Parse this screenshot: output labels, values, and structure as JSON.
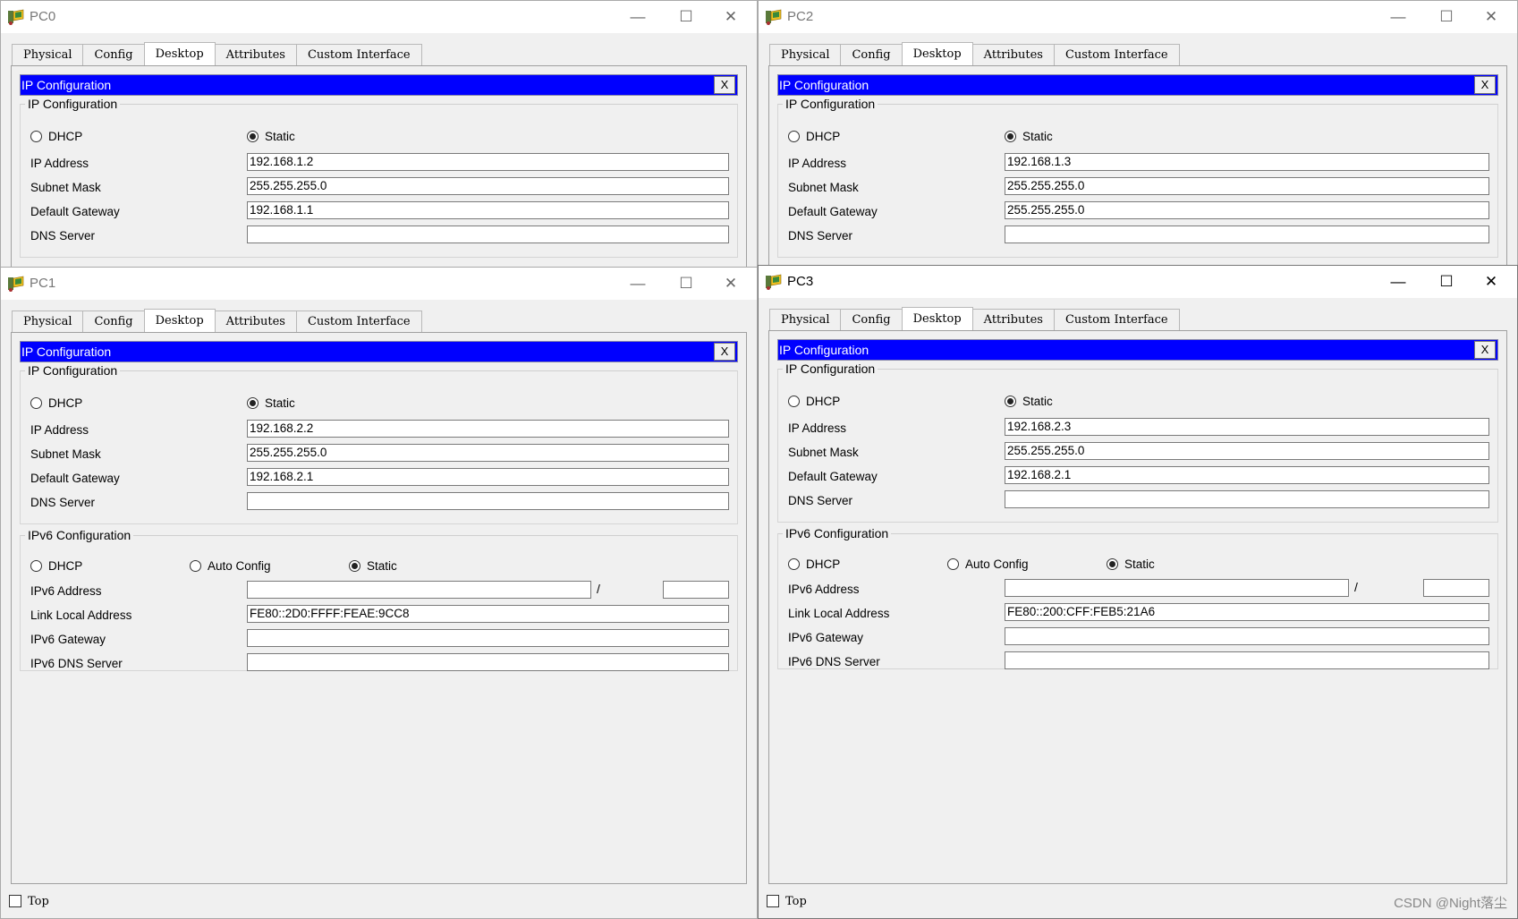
{
  "tabs": [
    "Physical",
    "Config",
    "Desktop",
    "Attributes",
    "Custom Interface"
  ],
  "ip_config_title": "IP Configuration",
  "close_x": "X",
  "labels": {
    "ipv4_group": "IP Configuration",
    "dhcp": "DHCP",
    "static": "Static",
    "ip_address": "IP Address",
    "subnet_mask": "Subnet Mask",
    "default_gateway": "Default Gateway",
    "dns_server": "DNS Server",
    "ipv6_group": "IPv6 Configuration",
    "auto_config": "Auto Config",
    "ipv6_address": "IPv6 Address",
    "link_local_address": "Link Local Address",
    "ipv6_gateway": "IPv6 Gateway",
    "ipv6_dns_server": "IPv6 DNS Server",
    "slash": "/",
    "top": "Top"
  },
  "window_controls": {
    "minimize": "—",
    "maximize": "☐",
    "close": "✕"
  },
  "windows": {
    "pc0": {
      "title": "PC0",
      "mode": "Static",
      "ip_address": "192.168.1.2",
      "subnet_mask": "255.255.255.0",
      "default_gateway": "192.168.1.1",
      "dns_server": ""
    },
    "pc2": {
      "title": "PC2",
      "mode": "Static",
      "ip_address": "192.168.1.3",
      "subnet_mask": "255.255.255.0",
      "default_gateway": "255.255.255.0",
      "dns_server": ""
    },
    "pc1": {
      "title": "PC1",
      "mode": "Static",
      "ip_address": "192.168.2.2",
      "subnet_mask": "255.255.255.0",
      "default_gateway": "192.168.2.1",
      "dns_server": "",
      "ipv6_mode": "Static",
      "ipv6_address": "",
      "ipv6_prefix": "",
      "link_local_address": "FE80::2D0:FFFF:FEAE:9CC8",
      "ipv6_gateway": "",
      "ipv6_dns_server": "",
      "top_checked": false
    },
    "pc3": {
      "title": "PC3",
      "mode": "Static",
      "ip_address": "192.168.2.3",
      "subnet_mask": "255.255.255.0",
      "default_gateway": "192.168.2.1",
      "dns_server": "",
      "ipv6_mode": "Static",
      "ipv6_address": "",
      "ipv6_prefix": "",
      "link_local_address": "FE80::200:CFF:FEB5:21A6",
      "ipv6_gateway": "",
      "ipv6_dns_server": "",
      "top_checked": false
    }
  },
  "watermark": "CSDN @Night落尘"
}
